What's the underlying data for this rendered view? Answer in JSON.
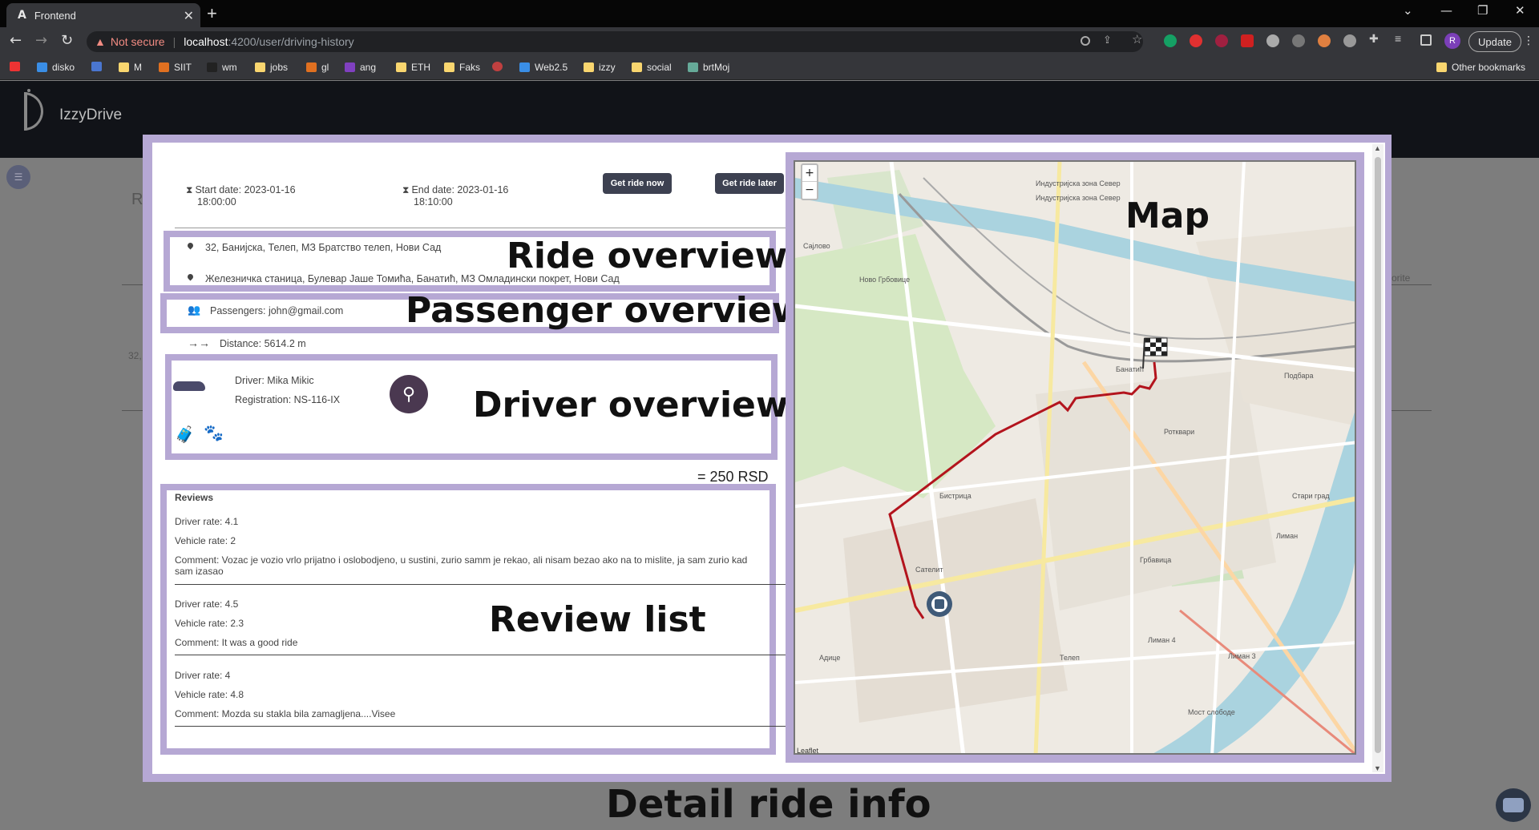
{
  "browser": {
    "tab_title": "Frontend",
    "tab_favicon": "A",
    "new_tab": "+",
    "security_warning": "Not secure",
    "url_host": "localhost",
    "url_path": ":4200/user/driving-history",
    "update_label": "Update",
    "avatar_letter": "R",
    "bookmarks": [
      "disko",
      "M",
      "SIIT",
      "wm",
      "jobs",
      "gl",
      "ang",
      "ETH",
      "Faks",
      "Web2.5",
      "izzy",
      "social",
      "brtMoj"
    ],
    "other_bookmarks": "Other bookmarks"
  },
  "app": {
    "brand": "IzzyDrive",
    "bg_title": "R",
    "bg_fav": "orite",
    "bg_row": "32,"
  },
  "ride": {
    "start_date": "Start date: 2023-01-16",
    "start_time": "18:00:00",
    "end_date": "End date: 2023-01-16",
    "end_time": "18:10:00",
    "get_ride_now": "Get ride now",
    "get_ride_later": "Get ride later",
    "from_address": "32, Банијска, Телеп, МЗ Братство телеп, Нови Сад",
    "to_address": "Железничка станица, Булевар Јаше Томића, Банатић, МЗ Омладински покрет, Нови Сад",
    "passengers": "Passengers: john@gmail.com",
    "distance_arrow": "→→",
    "distance": "Distance: 5614.2 m",
    "driver": "Driver: Mika Mikic",
    "registration": "Registration: NS-116-IX",
    "price": "= 250 RSD"
  },
  "annotations": {
    "ride_overview": "Ride overview",
    "passenger_overview": "Passenger overview",
    "driver_overview": "Driver overview",
    "review_list": "Review list",
    "map": "Map",
    "detail_ride_info": "Detail ride info"
  },
  "reviews": {
    "title": "Reviews",
    "items": [
      {
        "driver_rate": "Driver rate: 4.1",
        "vehicle_rate": "Vehicle rate: 2",
        "comment": "Comment: Vozac je vozio vrlo prijatno i oslobodjeno, u sustini, zurio samm je rekao, ali nisam bezao ako na to mislite, ja sam zurio kad",
        "comment2": "sam izasao"
      },
      {
        "driver_rate": "Driver rate: 4.5",
        "vehicle_rate": "Vehicle rate: 2.3",
        "comment": "Comment: It was a good ride",
        "comment2": ""
      },
      {
        "driver_rate": "Driver rate: 4",
        "vehicle_rate": "Vehicle rate: 4.8",
        "comment": "Comment: Mozda su stakla bila zamagljena....Visee",
        "comment2": ""
      }
    ]
  },
  "map": {
    "zoom_in": "+",
    "zoom_out": "−",
    "attribution": "Leaflet",
    "labels": [
      "Индустријска зона Север",
      "Индустријска зона Север",
      "Сајлово",
      "Ново Грбовице",
      "Банатић",
      "Подбара",
      "Ротквари",
      "Лиман",
      "Сателит",
      "Адице",
      "Телеп",
      "Мост слободе",
      "Стари град",
      "Грбавица",
      "Лиман 4",
      "Лиман 3",
      "Бистрица"
    ],
    "route_color": "#b3141d"
  },
  "colors": {
    "frame": "#b6a8d4",
    "button": "#3d4151"
  }
}
